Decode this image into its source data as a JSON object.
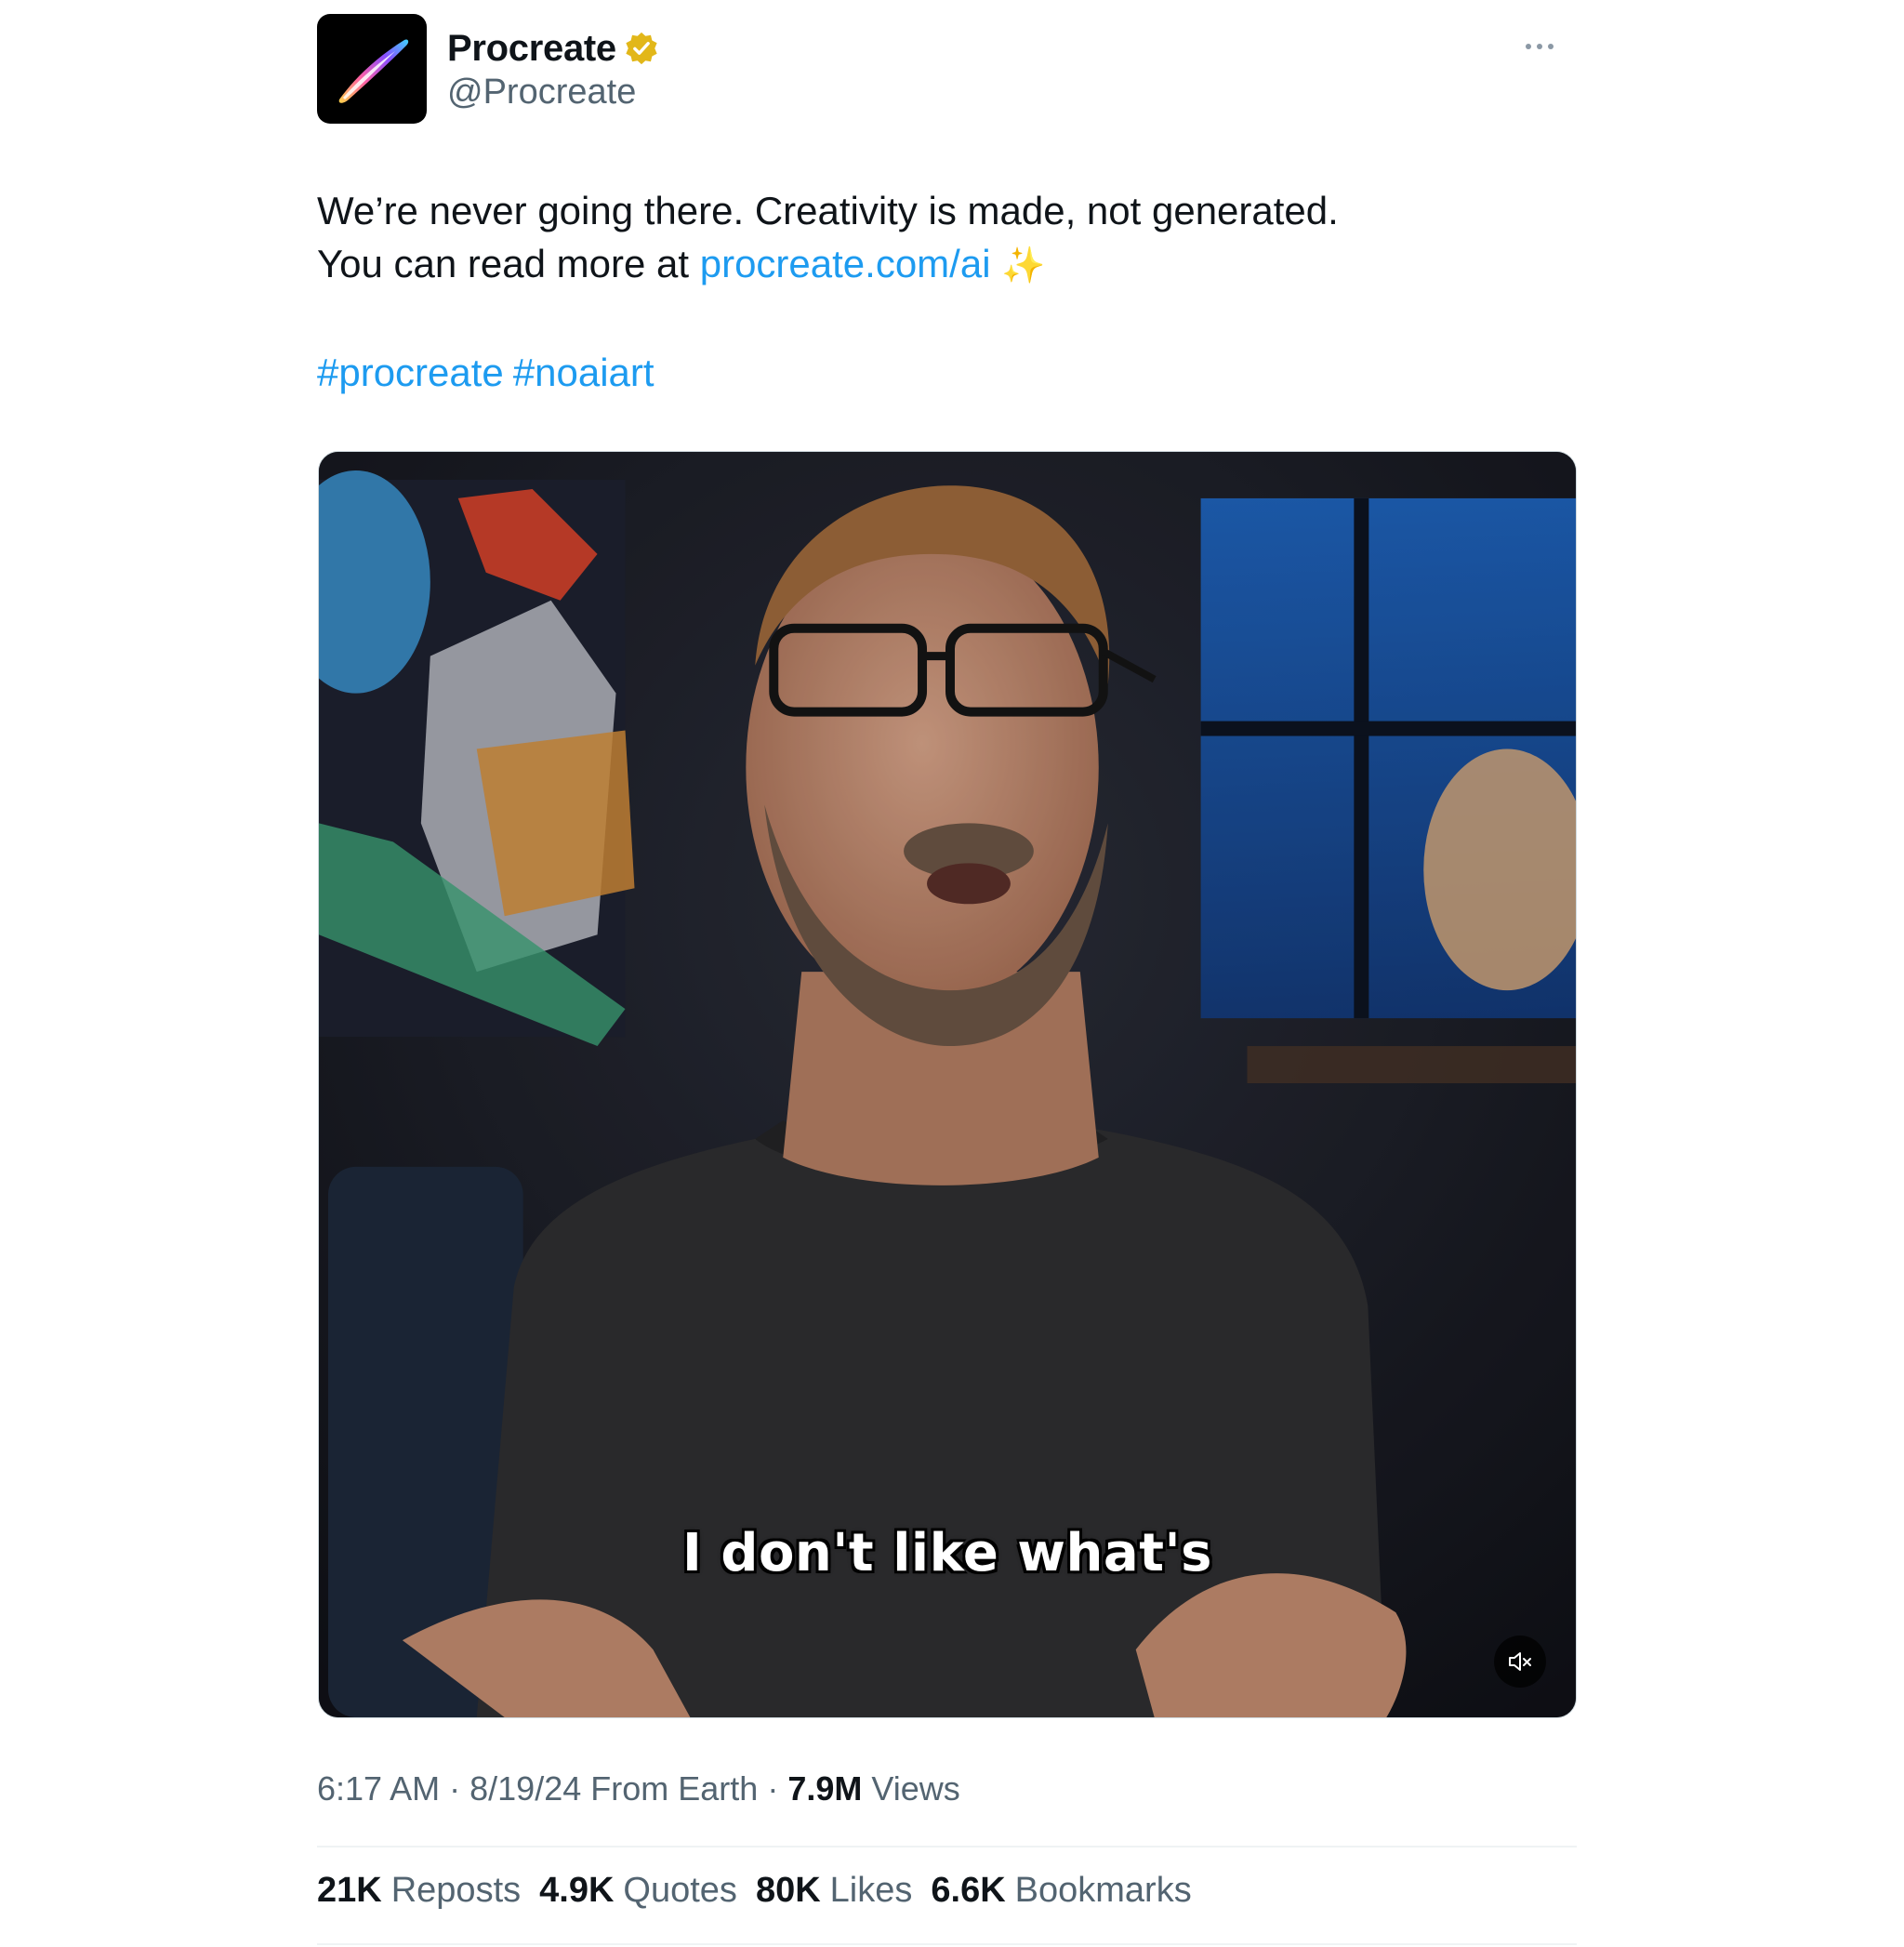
{
  "author": {
    "display_name": "Procreate",
    "handle": "@Procreate",
    "verified_icon": "verified-badge-gold",
    "avatar_icon": "procreate-brush-logo"
  },
  "tweet": {
    "text_line1": "We’re never going there. Creativity is made, not generated.",
    "text_line2_prefix": "You can read more at ",
    "link_text": "procreate.com/ai",
    "emoji": "✨",
    "hashtags": [
      "#procreate",
      "#noaiart"
    ]
  },
  "media": {
    "caption": "I don't like what's",
    "mute_icon": "speaker-muted-icon"
  },
  "meta": {
    "time": "6:17 AM",
    "separator": "·",
    "date": "8/19/24",
    "source": "From Earth",
    "views_count": "7.9M",
    "views_label": "Views"
  },
  "stats": [
    {
      "count": "21K",
      "label": "Reposts"
    },
    {
      "count": "4.9K",
      "label": "Quotes"
    },
    {
      "count": "80K",
      "label": "Likes"
    },
    {
      "count": "6.6K",
      "label": "Bookmarks"
    }
  ],
  "colors": {
    "link": "#1d9bf0",
    "secondary_text": "#536471",
    "primary_text": "#0f1419",
    "verified": "#e2b719"
  }
}
